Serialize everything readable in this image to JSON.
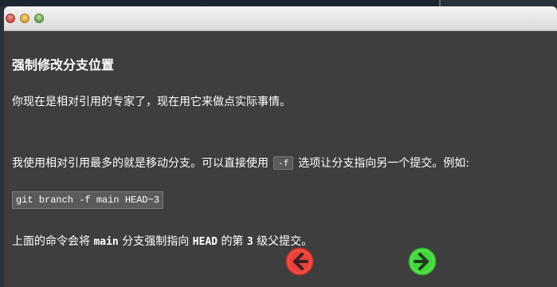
{
  "window": {
    "traffic_lights": [
      "close",
      "minimize",
      "zoom"
    ]
  },
  "dialog": {
    "title": "强制修改分支位置",
    "paragraph1": "你现在是相对引用的专家了，现在用它来做点实际事情。",
    "paragraph2_before": "我使用相对引用最多的就是移动分支。可以直接使用",
    "paragraph2_code": "-f",
    "paragraph2_after": "选项让分支指向另一个提交。例如:",
    "code_example": "git branch -f main HEAD~3",
    "paragraph3_part1": "上面的命令会将",
    "paragraph3_branch": "main",
    "paragraph3_part2": "分支强制指向",
    "paragraph3_head": "HEAD",
    "paragraph3_part3": "的第",
    "paragraph3_num": "3",
    "paragraph3_part4": "级父提交。"
  },
  "navigation": {
    "prev_icon": "arrow-left-icon",
    "next_icon": "arrow-right-icon",
    "prev_color": "#e8413a",
    "next_color": "#44d63c"
  }
}
